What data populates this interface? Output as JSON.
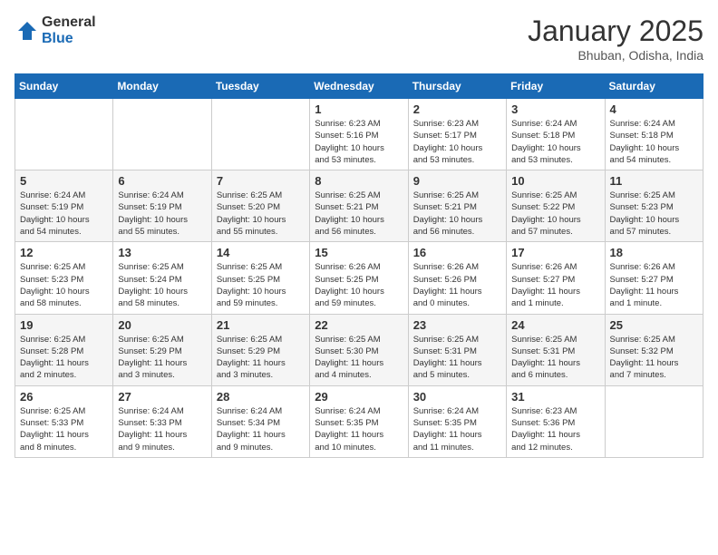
{
  "logo": {
    "general": "General",
    "blue": "Blue"
  },
  "header": {
    "month": "January 2025",
    "location": "Bhuban, Odisha, India"
  },
  "weekdays": [
    "Sunday",
    "Monday",
    "Tuesday",
    "Wednesday",
    "Thursday",
    "Friday",
    "Saturday"
  ],
  "weeks": [
    [
      {
        "day": "",
        "info": ""
      },
      {
        "day": "",
        "info": ""
      },
      {
        "day": "",
        "info": ""
      },
      {
        "day": "1",
        "info": "Sunrise: 6:23 AM\nSunset: 5:16 PM\nDaylight: 10 hours\nand 53 minutes."
      },
      {
        "day": "2",
        "info": "Sunrise: 6:23 AM\nSunset: 5:17 PM\nDaylight: 10 hours\nand 53 minutes."
      },
      {
        "day": "3",
        "info": "Sunrise: 6:24 AM\nSunset: 5:18 PM\nDaylight: 10 hours\nand 53 minutes."
      },
      {
        "day": "4",
        "info": "Sunrise: 6:24 AM\nSunset: 5:18 PM\nDaylight: 10 hours\nand 54 minutes."
      }
    ],
    [
      {
        "day": "5",
        "info": "Sunrise: 6:24 AM\nSunset: 5:19 PM\nDaylight: 10 hours\nand 54 minutes."
      },
      {
        "day": "6",
        "info": "Sunrise: 6:24 AM\nSunset: 5:19 PM\nDaylight: 10 hours\nand 55 minutes."
      },
      {
        "day": "7",
        "info": "Sunrise: 6:25 AM\nSunset: 5:20 PM\nDaylight: 10 hours\nand 55 minutes."
      },
      {
        "day": "8",
        "info": "Sunrise: 6:25 AM\nSunset: 5:21 PM\nDaylight: 10 hours\nand 56 minutes."
      },
      {
        "day": "9",
        "info": "Sunrise: 6:25 AM\nSunset: 5:21 PM\nDaylight: 10 hours\nand 56 minutes."
      },
      {
        "day": "10",
        "info": "Sunrise: 6:25 AM\nSunset: 5:22 PM\nDaylight: 10 hours\nand 57 minutes."
      },
      {
        "day": "11",
        "info": "Sunrise: 6:25 AM\nSunset: 5:23 PM\nDaylight: 10 hours\nand 57 minutes."
      }
    ],
    [
      {
        "day": "12",
        "info": "Sunrise: 6:25 AM\nSunset: 5:23 PM\nDaylight: 10 hours\nand 58 minutes."
      },
      {
        "day": "13",
        "info": "Sunrise: 6:25 AM\nSunset: 5:24 PM\nDaylight: 10 hours\nand 58 minutes."
      },
      {
        "day": "14",
        "info": "Sunrise: 6:25 AM\nSunset: 5:25 PM\nDaylight: 10 hours\nand 59 minutes."
      },
      {
        "day": "15",
        "info": "Sunrise: 6:26 AM\nSunset: 5:25 PM\nDaylight: 10 hours\nand 59 minutes."
      },
      {
        "day": "16",
        "info": "Sunrise: 6:26 AM\nSunset: 5:26 PM\nDaylight: 11 hours\nand 0 minutes."
      },
      {
        "day": "17",
        "info": "Sunrise: 6:26 AM\nSunset: 5:27 PM\nDaylight: 11 hours\nand 1 minute."
      },
      {
        "day": "18",
        "info": "Sunrise: 6:26 AM\nSunset: 5:27 PM\nDaylight: 11 hours\nand 1 minute."
      }
    ],
    [
      {
        "day": "19",
        "info": "Sunrise: 6:25 AM\nSunset: 5:28 PM\nDaylight: 11 hours\nand 2 minutes."
      },
      {
        "day": "20",
        "info": "Sunrise: 6:25 AM\nSunset: 5:29 PM\nDaylight: 11 hours\nand 3 minutes."
      },
      {
        "day": "21",
        "info": "Sunrise: 6:25 AM\nSunset: 5:29 PM\nDaylight: 11 hours\nand 3 minutes."
      },
      {
        "day": "22",
        "info": "Sunrise: 6:25 AM\nSunset: 5:30 PM\nDaylight: 11 hours\nand 4 minutes."
      },
      {
        "day": "23",
        "info": "Sunrise: 6:25 AM\nSunset: 5:31 PM\nDaylight: 11 hours\nand 5 minutes."
      },
      {
        "day": "24",
        "info": "Sunrise: 6:25 AM\nSunset: 5:31 PM\nDaylight: 11 hours\nand 6 minutes."
      },
      {
        "day": "25",
        "info": "Sunrise: 6:25 AM\nSunset: 5:32 PM\nDaylight: 11 hours\nand 7 minutes."
      }
    ],
    [
      {
        "day": "26",
        "info": "Sunrise: 6:25 AM\nSunset: 5:33 PM\nDaylight: 11 hours\nand 8 minutes."
      },
      {
        "day": "27",
        "info": "Sunrise: 6:24 AM\nSunset: 5:33 PM\nDaylight: 11 hours\nand 9 minutes."
      },
      {
        "day": "28",
        "info": "Sunrise: 6:24 AM\nSunset: 5:34 PM\nDaylight: 11 hours\nand 9 minutes."
      },
      {
        "day": "29",
        "info": "Sunrise: 6:24 AM\nSunset: 5:35 PM\nDaylight: 11 hours\nand 10 minutes."
      },
      {
        "day": "30",
        "info": "Sunrise: 6:24 AM\nSunset: 5:35 PM\nDaylight: 11 hours\nand 11 minutes."
      },
      {
        "day": "31",
        "info": "Sunrise: 6:23 AM\nSunset: 5:36 PM\nDaylight: 11 hours\nand 12 minutes."
      },
      {
        "day": "",
        "info": ""
      }
    ]
  ]
}
